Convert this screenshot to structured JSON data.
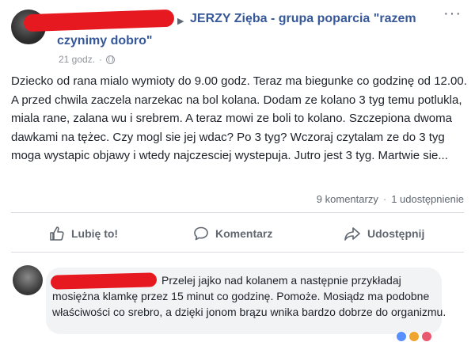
{
  "header": {
    "group_name_line1": "JERZY Zięba - grupa poparcia \"razem",
    "group_name_line2": "czynimy dobro\"",
    "time": "21 godz.",
    "separator": "·"
  },
  "post": {
    "text": "Dziecko od rana mialo wymioty do 9.00 godz. Teraz ma biegunke co godzinę od 12.00. A przed chwila zaczela narzekac na bol kolana. Dodam ze kolano 3 tyg temu potlukla, miala rane, zalana wu i srebrem. A teraz mowi ze boli to kolano. Szczepiona dwoma dawkami na tężec. Czy mogl sie jej wdac? Po 3 tyg? Wczoraj czytalam ze do 3 tyg moga wystapic objawy i wtedy najczesciej wystepuja. Jutro jest 3 tyg. Martwie sie..."
  },
  "stats": {
    "comments": "9 komentarzy",
    "shares": "1 udostępnienie",
    "separator": "·"
  },
  "actions": {
    "like": "Lubię to!",
    "comment": "Komentarz",
    "share": "Udostępnij"
  },
  "comment": {
    "text": "Przelej jajko nad kolanem a następnie przykładaj mosiężna klamkę przez 15 minut co godzinę. Pomoże. Mosiądz ma podobne właściwości co srebro, a dzięki jonom brązu wnika bardzo dobrze do organizmu."
  },
  "colors": {
    "link": "#365899",
    "redaction": "#e5191f",
    "muted": "#606770",
    "bubble": "#f2f3f5"
  },
  "icons": [
    "thumbs-up-icon",
    "comment-icon",
    "share-icon",
    "globe-icon",
    "more-dots-icon",
    "caret-right-icon"
  ]
}
